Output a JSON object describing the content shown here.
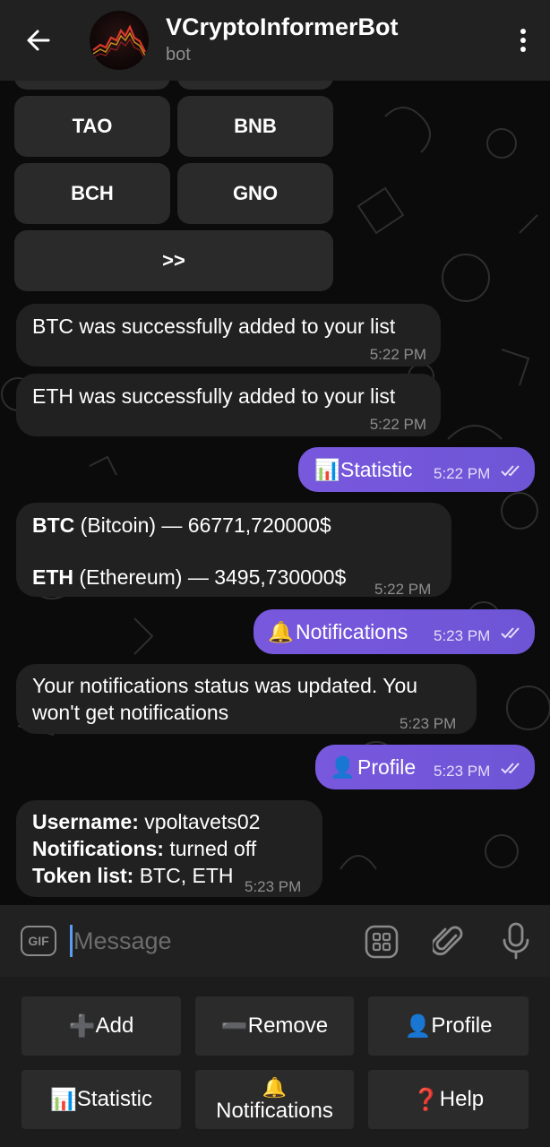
{
  "header": {
    "title": "VCryptoInformerBot",
    "subtitle": "bot"
  },
  "inline_keyboard": {
    "buttons": [
      "TAO",
      "BNB",
      "BCH",
      "GNO",
      ">>"
    ]
  },
  "messages": [
    {
      "dir": "in",
      "text": "BTC was successfully added to your list",
      "time": "5:22 PM"
    },
    {
      "dir": "in",
      "text": "ETH was successfully added to your list",
      "time": "5:22 PM"
    },
    {
      "dir": "out",
      "icon": "📊",
      "text": "Statistic",
      "time": "5:22 PM"
    },
    {
      "dir": "in",
      "line1_bold": "BTC",
      "line1_rest": " (Bitcoin) — 66771,720000$",
      "line2_bold": "ETH",
      "line2_rest": " (Ethereum) — 3495,730000$",
      "time": "5:22 PM"
    },
    {
      "dir": "out",
      "icon": "🔔",
      "text": "Notifications",
      "time": "5:23 PM"
    },
    {
      "dir": "in",
      "line1": "Your notifications status was updated. You",
      "line2": "won't get notifications",
      "time": "5:23 PM"
    },
    {
      "dir": "out",
      "icon": "👤",
      "text": "Profile",
      "time": "5:23 PM"
    },
    {
      "dir": "in",
      "line1_bold": "Username:",
      "line1_rest": " vpoltavets02",
      "line2_bold": "Notifications:",
      "line2_rest": " turned off",
      "line3_bold": "Token list:",
      "line3_rest": " BTC, ETH",
      "time": "5:23 PM"
    }
  ],
  "composer": {
    "gif_label": "GIF",
    "placeholder": "Message"
  },
  "reply_keyboard": {
    "add": {
      "icon": "➕",
      "label": "Add"
    },
    "remove": {
      "icon": "➖",
      "label": "Remove"
    },
    "profile": {
      "icon": "👤",
      "label": "Profile"
    },
    "statistic": {
      "icon": "📊",
      "label": "Statistic"
    },
    "notifications": {
      "icon": "🔔",
      "label": "Notifications"
    },
    "help": {
      "icon": "❓",
      "label": "Help"
    }
  },
  "colors": {
    "outgoing_bubble": "#7457d9",
    "incoming_bubble": "#212121",
    "header_bg": "#212121",
    "caret": "#5e9bf2"
  }
}
